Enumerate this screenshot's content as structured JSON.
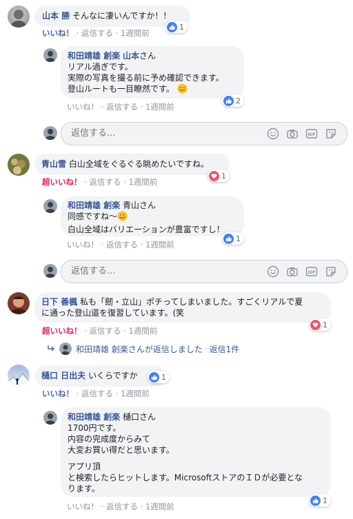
{
  "actions": {
    "like": "いいね！",
    "super_like": "超いいね！",
    "reply": "返信する",
    "sep": "·"
  },
  "reply_placeholder": "返信する...",
  "comments": [
    {
      "name": "山本 勝",
      "text": "そんなに凄いんですか！！",
      "time": "1週間前",
      "like_label": "いいね！",
      "reaction": "like",
      "count": "1"
    },
    {
      "name": "和田靖雄 創楽",
      "tag": "山本",
      "suffix": "さん",
      "lines": [
        "リアル過ぎです。",
        "実際の写真を撮る前に予め確認できます。",
        "登山ルートも一目瞭然です。"
      ],
      "time": "1週間前",
      "reaction": "like",
      "count": "2"
    },
    {
      "name": "青山雪",
      "text": "白山全域をぐるぐる眺めたいですね。",
      "time": "1週間前",
      "reaction": "love",
      "count": "1"
    },
    {
      "name": "和田靖雄 創楽",
      "tag": "青山",
      "suffix": "さん",
      "lines": [
        "同感ですね～",
        "白山全域はバリエーションが豊富ですし！"
      ],
      "time": "1週間前",
      "reaction": "like",
      "count": "1"
    },
    {
      "name": "日下 善楓",
      "lines": [
        "私も「劒・立山」ポチってしまいました。すごくリアルで夏",
        "に通った登山道を復習しています。(笑"
      ],
      "time": "1週間前",
      "reaction": "love",
      "count": "1"
    },
    {
      "name": "樋口 日出夫",
      "text": "いくらですか",
      "time": "1週間前",
      "reaction": "like",
      "count": "1"
    },
    {
      "name": "和田靖雄 創楽",
      "tag": "樋口",
      "suffix": "さん",
      "lines": [
        "1700円です。",
        "内容の完成度からみて",
        "大変お買い得だと思います。"
      ],
      "lines2": [
        "アプリ頂",
        "と検索したらヒットします。MicrosoftストアのＩＤが必要とな",
        "ります。"
      ],
      "time": "1週間前",
      "reaction": "like",
      "count": "1"
    }
  ],
  "replied": {
    "text": "和田靖雄 創楽さんが返信しました",
    "sep": "·",
    "count": "返信1件"
  },
  "colors": {
    "link": "#385898",
    "like_blue": "#4267b2",
    "love": "#e0245e",
    "bubble": "#f2f3f5",
    "meta": "#90949c"
  }
}
